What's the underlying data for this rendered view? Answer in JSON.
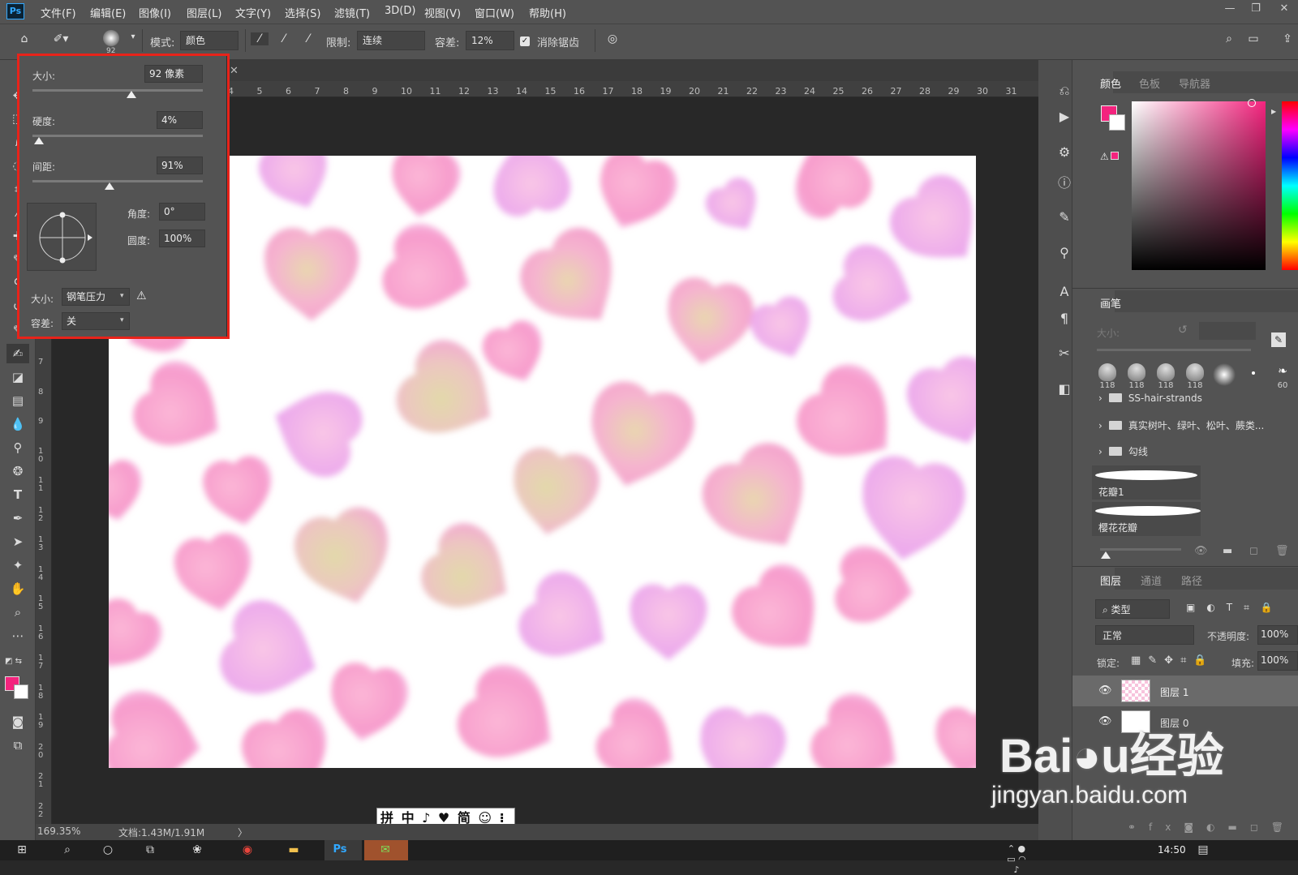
{
  "app": {
    "logo": "Ps"
  },
  "menu": [
    "文件(F)",
    "编辑(E)",
    "图像(I)",
    "图层(L)",
    "文字(Y)",
    "选择(S)",
    "滤镜(T)",
    "3D(D)",
    "视图(V)",
    "窗口(W)",
    "帮助(H)"
  ],
  "window_controls": {
    "minimize": "—",
    "restore": "❐",
    "close": "✕"
  },
  "options": {
    "brush_size_badge": "92",
    "mode_label": "模式:",
    "mode_value": "颜色",
    "limit_label": "限制:",
    "limit_value": "连续",
    "tolerance_label": "容差:",
    "tolerance_value": "12%",
    "antialias_label": "消除锯齿"
  },
  "brush_popup": {
    "size_label": "大小:",
    "size_value": "92 像素",
    "size_level": 0.58,
    "hardness_label": "硬度:",
    "hardness_value": "4%",
    "hardness_level": 0.04,
    "spacing_label": "间距:",
    "spacing_value": "91%",
    "spacing_level": 0.45,
    "angle_label": "角度:",
    "angle_value": "0°",
    "roundness_label": "圆度:",
    "roundness_value": "100%",
    "dyn_size_label": "大小:",
    "dyn_size_value": "钢笔压力",
    "tolerance_label": "容差:",
    "tolerance_value": "关"
  },
  "ruler": {
    "h": [
      "4",
      "5",
      "6",
      "7",
      "8",
      "9",
      "10",
      "11",
      "12",
      "13",
      "14",
      "15",
      "16",
      "17",
      "18",
      "19",
      "20",
      "21",
      "22",
      "23",
      "24",
      "25",
      "26",
      "27",
      "28",
      "29",
      "30",
      "31"
    ],
    "v": [
      "7",
      "8",
      "9",
      "10",
      "11",
      "12",
      "13",
      "14",
      "15",
      "16",
      "17",
      "18",
      "19",
      "20",
      "21",
      "22"
    ]
  },
  "status": {
    "zoom": "169.35%",
    "doc": "文档:1.43M/1.91M",
    "arrow": "〉"
  },
  "ime": {
    "text": "拼 中 ♪ ♥ 简 ☺ ⁝"
  },
  "color_panel": {
    "tabs": [
      "颜色",
      "色板",
      "导航器"
    ]
  },
  "brushes_panel": {
    "tab": "画笔",
    "size_label": "大小:",
    "presets": [
      "118",
      "118",
      "118",
      "118",
      "",
      "",
      "60"
    ],
    "folders": [
      "SS-hair-strands",
      "真实树叶、绿叶、松叶、蕨类...",
      "勾线"
    ],
    "strokes": [
      "花瓣1",
      "樱花花瓣"
    ]
  },
  "layers_panel": {
    "tabs": [
      "图层",
      "通道",
      "路径"
    ],
    "filter": "类型",
    "blend": "正常",
    "opacity_label": "不透明度:",
    "opacity_value": "100%",
    "lock_label": "锁定:",
    "fill_label": "填充:",
    "fill_value": "100%",
    "layers": [
      {
        "name": "图层 1",
        "selected": true
      },
      {
        "name": "图层 0",
        "selected": false
      }
    ]
  },
  "taskbar": {
    "time": "14:50"
  },
  "watermark": {
    "line1": "Bai◕u经验",
    "line2": "jingyan.baidu.com"
  },
  "colors": {
    "foreground": "#f4247e",
    "background": "#ffffff",
    "highlight": "#e8231a"
  }
}
